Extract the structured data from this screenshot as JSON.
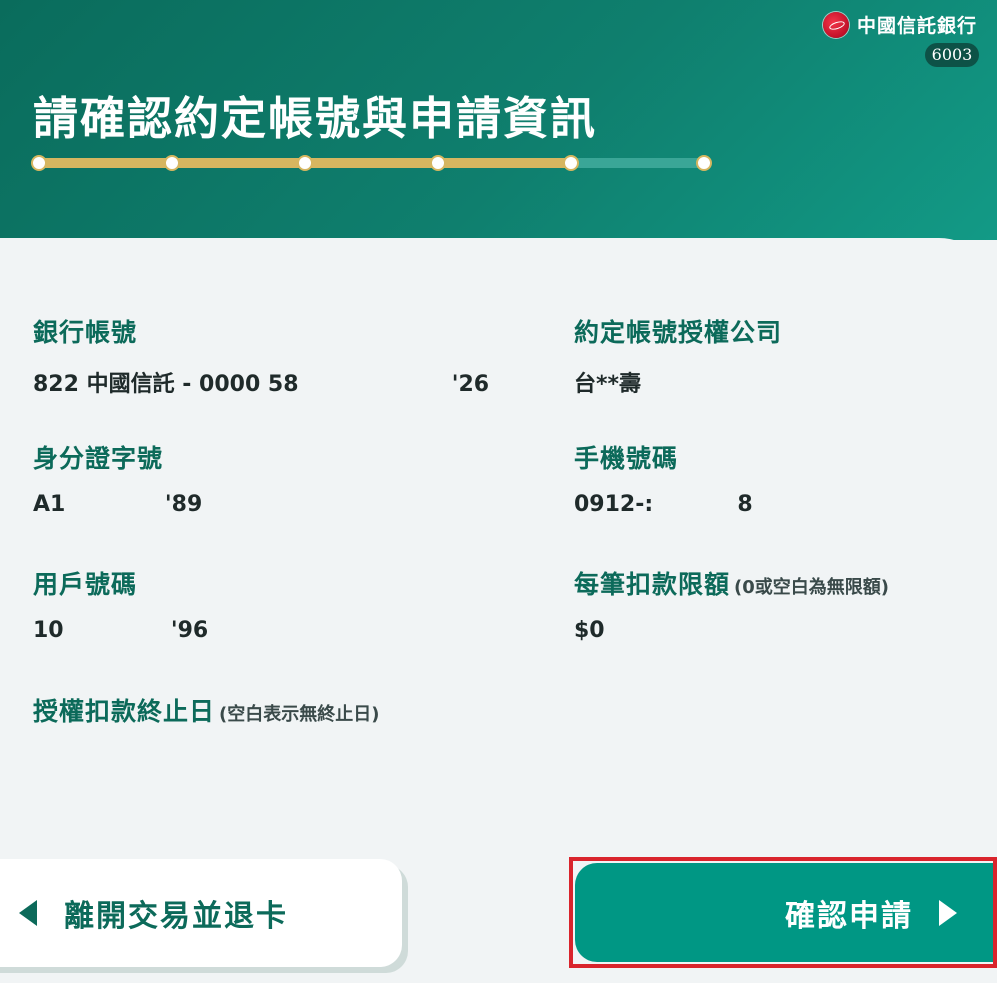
{
  "brand": {
    "name": "中國信託銀行",
    "kiosk_id": "6003",
    "logo_icon": "ctbc-logo-icon"
  },
  "header": {
    "title": "請確認約定帳號與申請資訊"
  },
  "progress": {
    "total_steps": 6,
    "current_step": 5
  },
  "fields": {
    "bank_account": {
      "label": "銀行帳號",
      "value": "822 中國信託 - 0000 58                    '26"
    },
    "authorized_company": {
      "label": "約定帳號授權公司",
      "value": "台**壽"
    },
    "id_number": {
      "label": "身分證字號",
      "value": "A1             '89"
    },
    "mobile": {
      "label": "手機號碼",
      "value": "0912-:           8"
    },
    "user_number": {
      "label": "用戶號碼",
      "value": "10              '96"
    },
    "limit": {
      "label": "每筆扣款限額",
      "note": "(0或空白為無限額)",
      "value": "$0"
    },
    "end_date": {
      "label": "授權扣款終止日",
      "note": "(空白表示無終止日)",
      "value": ""
    }
  },
  "buttons": {
    "exit_label": "離開交易並退卡",
    "confirm_label": "確認申請"
  },
  "colors": {
    "header": "#0f7f6e",
    "accent": "#009784",
    "progress_done": "#d6b660",
    "highlight": "#d9242c"
  }
}
